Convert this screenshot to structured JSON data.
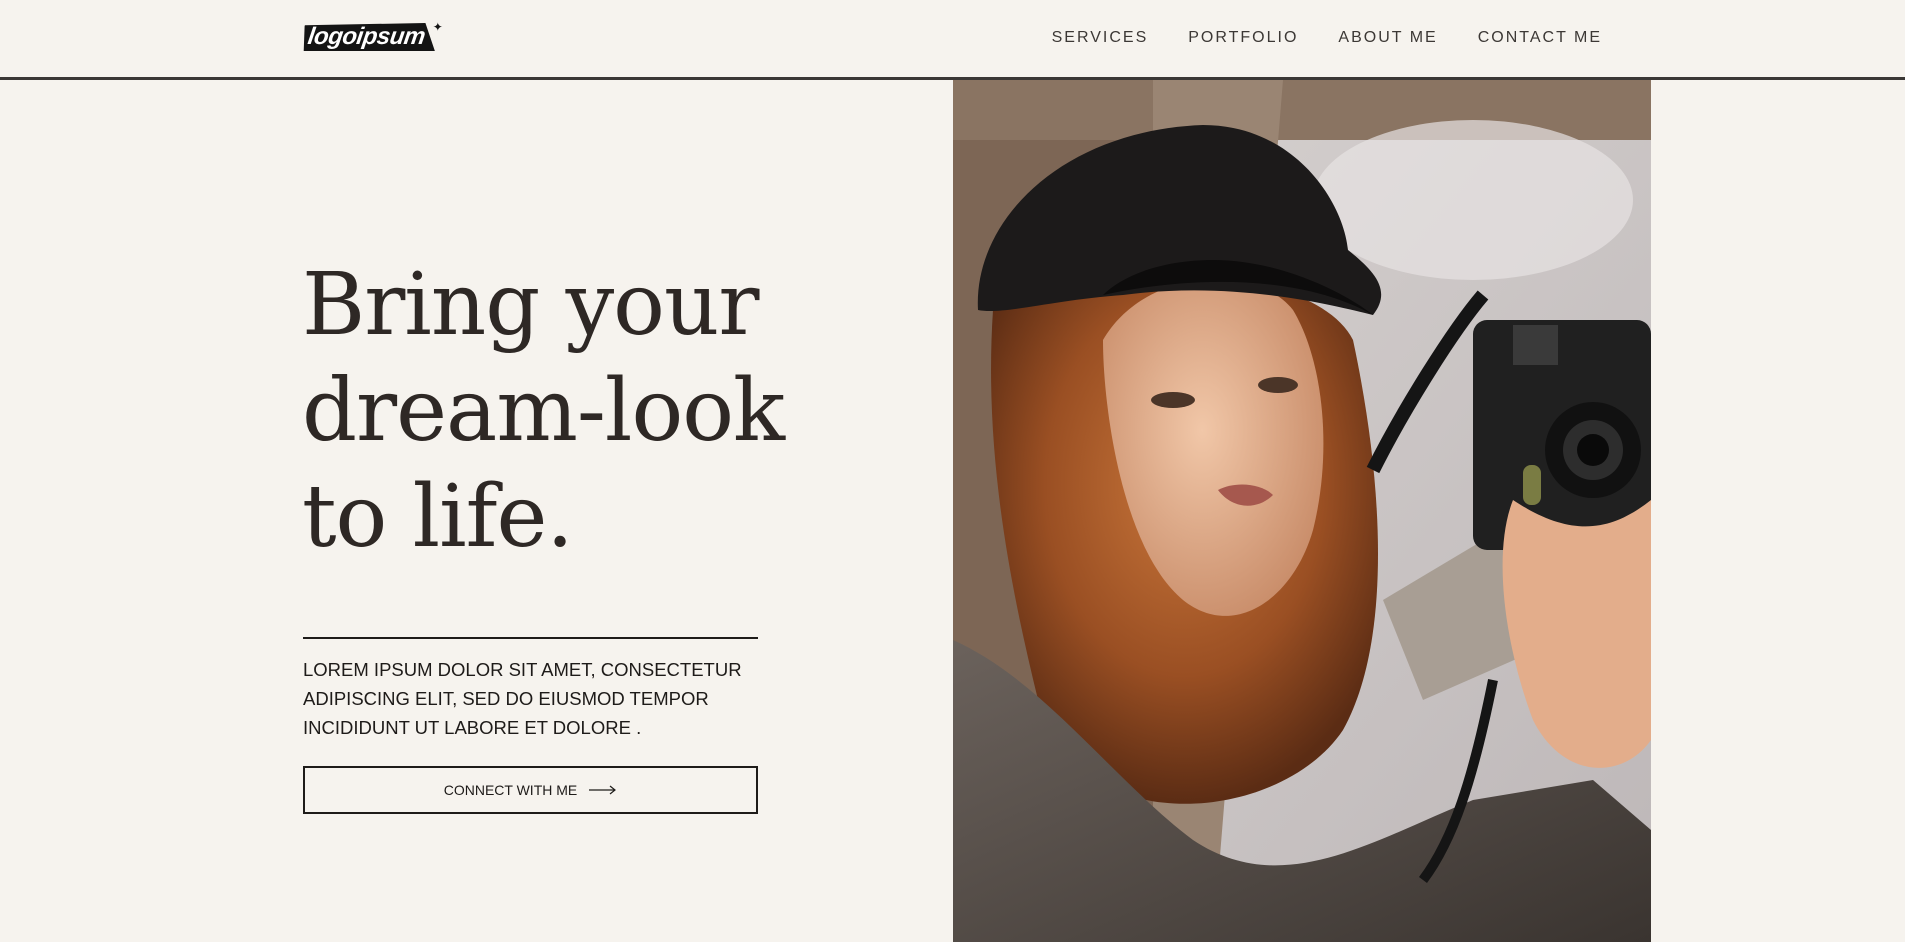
{
  "brand": {
    "logo_text": "logoipsum"
  },
  "nav": {
    "items": [
      "SERVICES",
      "PORTFOLIO",
      "ABOUT ME",
      "CONTACT ME"
    ]
  },
  "hero": {
    "title_lines": [
      "Bring your",
      "dream-look",
      "to life."
    ],
    "blurb_lines": [
      "LOREM IPSUM DOLOR SIT AMET, CONSECTETUR",
      "ADIPISCING ELIT, SED DO EIUSMOD TEMPOR",
      "INCIDIDUNT UT LABORE ET DOLORE ."
    ],
    "cta_label": "CONNECT WITH ME",
    "cta_icon": "arrow-right-icon"
  },
  "colors": {
    "background": "#f6f3ee",
    "text": "#2e2825",
    "border": "#1e1b19"
  }
}
